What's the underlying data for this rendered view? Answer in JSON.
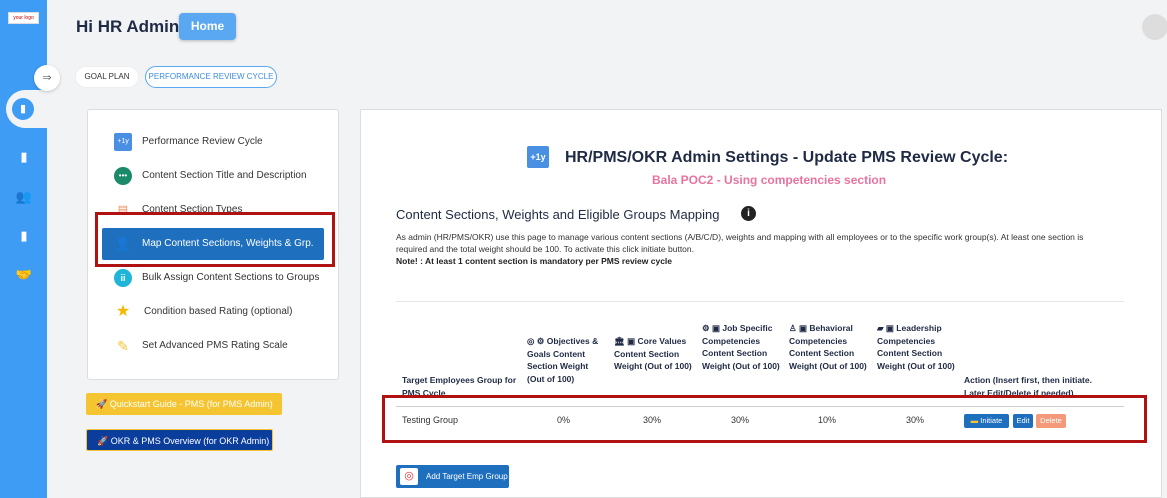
{
  "rail": {
    "logo": "your logo",
    "icons": [
      "book-icon",
      "users-icon",
      "book-icon",
      "handshake-icon"
    ]
  },
  "header": {
    "greeting": "Hi HR Admin",
    "home_label": "Home"
  },
  "tabs": {
    "goal_plan": "GOAL PLAN",
    "performance_review_cycle": "PERFORMANCE REVIEW CYCLE"
  },
  "menu": {
    "items": [
      {
        "label": "Performance Review Cycle",
        "icon": "calendar-icon"
      },
      {
        "label": "Content Section Title and Description",
        "icon": "dots-icon"
      },
      {
        "label": "Content Section Types",
        "icon": "table-icon"
      },
      {
        "label": "Map Content Sections, Weights & Grp.",
        "icon": "map-user-icon"
      },
      {
        "label": "Bulk Assign Content Sections to Groups",
        "icon": "group-icon"
      },
      {
        "label": "Condition based Rating (optional)",
        "icon": "star-icon"
      },
      {
        "label": "Set Advanced PMS Rating Scale",
        "icon": "ruler-icon"
      }
    ]
  },
  "buttons": {
    "quickstart": "Quickstart Guide - PMS (for PMS Admin)",
    "overview": "OKR & PMS Overview (for OKR Admin)",
    "add_target": "Add Target Emp Group"
  },
  "panel": {
    "title_icon": "+1y",
    "title": "HR/PMS/OKR Admin Settings - Update PMS Review Cycle:",
    "subtitle": "Bala POC2 - Using competencies section",
    "section_title": "Content Sections, Weights and Eligible Groups Mapping",
    "description": "As admin (HR/PMS/OKR) use this page to manage various content sections (A/B/C/D), weights and mapping with all employees or to the specific work group(s). At least one section is required and the total weight should be 100. To activate this click initiate button.",
    "note": "Note! : At least 1 content section is mandatory per PMS review cycle"
  },
  "table": {
    "headers": [
      "Target Employees Group for PMS Cycle",
      "Objectives & Goals Content Section Weight (Out of 100)",
      "Core Values Content Section Weight (Out of 100)",
      "Job Specific Competencies Content Section Weight (Out of 100)",
      "Behavioral Competencies Content Section Weight (Out of 100)",
      "Leadership Competencies Content Section Weight (Out of 100)",
      "Action (Insert first, then initiate. Later Edit/Delete if needed)"
    ],
    "row": {
      "group": "Testing Group",
      "w1": "0%",
      "w2": "30%",
      "w3": "30%",
      "w4": "10%",
      "w5": "30%"
    },
    "actions": {
      "initiate": "Initiate",
      "edit": "Edit",
      "delete": "Delete"
    }
  },
  "colors": {
    "rail": "#3e9cf5",
    "active_menu": "#1f6fbf",
    "highlight": "#b01212",
    "subtitle": "#e8739e",
    "quickstart": "#f5c531",
    "overview": "#0b3e9c",
    "delete": "#f49a7a"
  }
}
